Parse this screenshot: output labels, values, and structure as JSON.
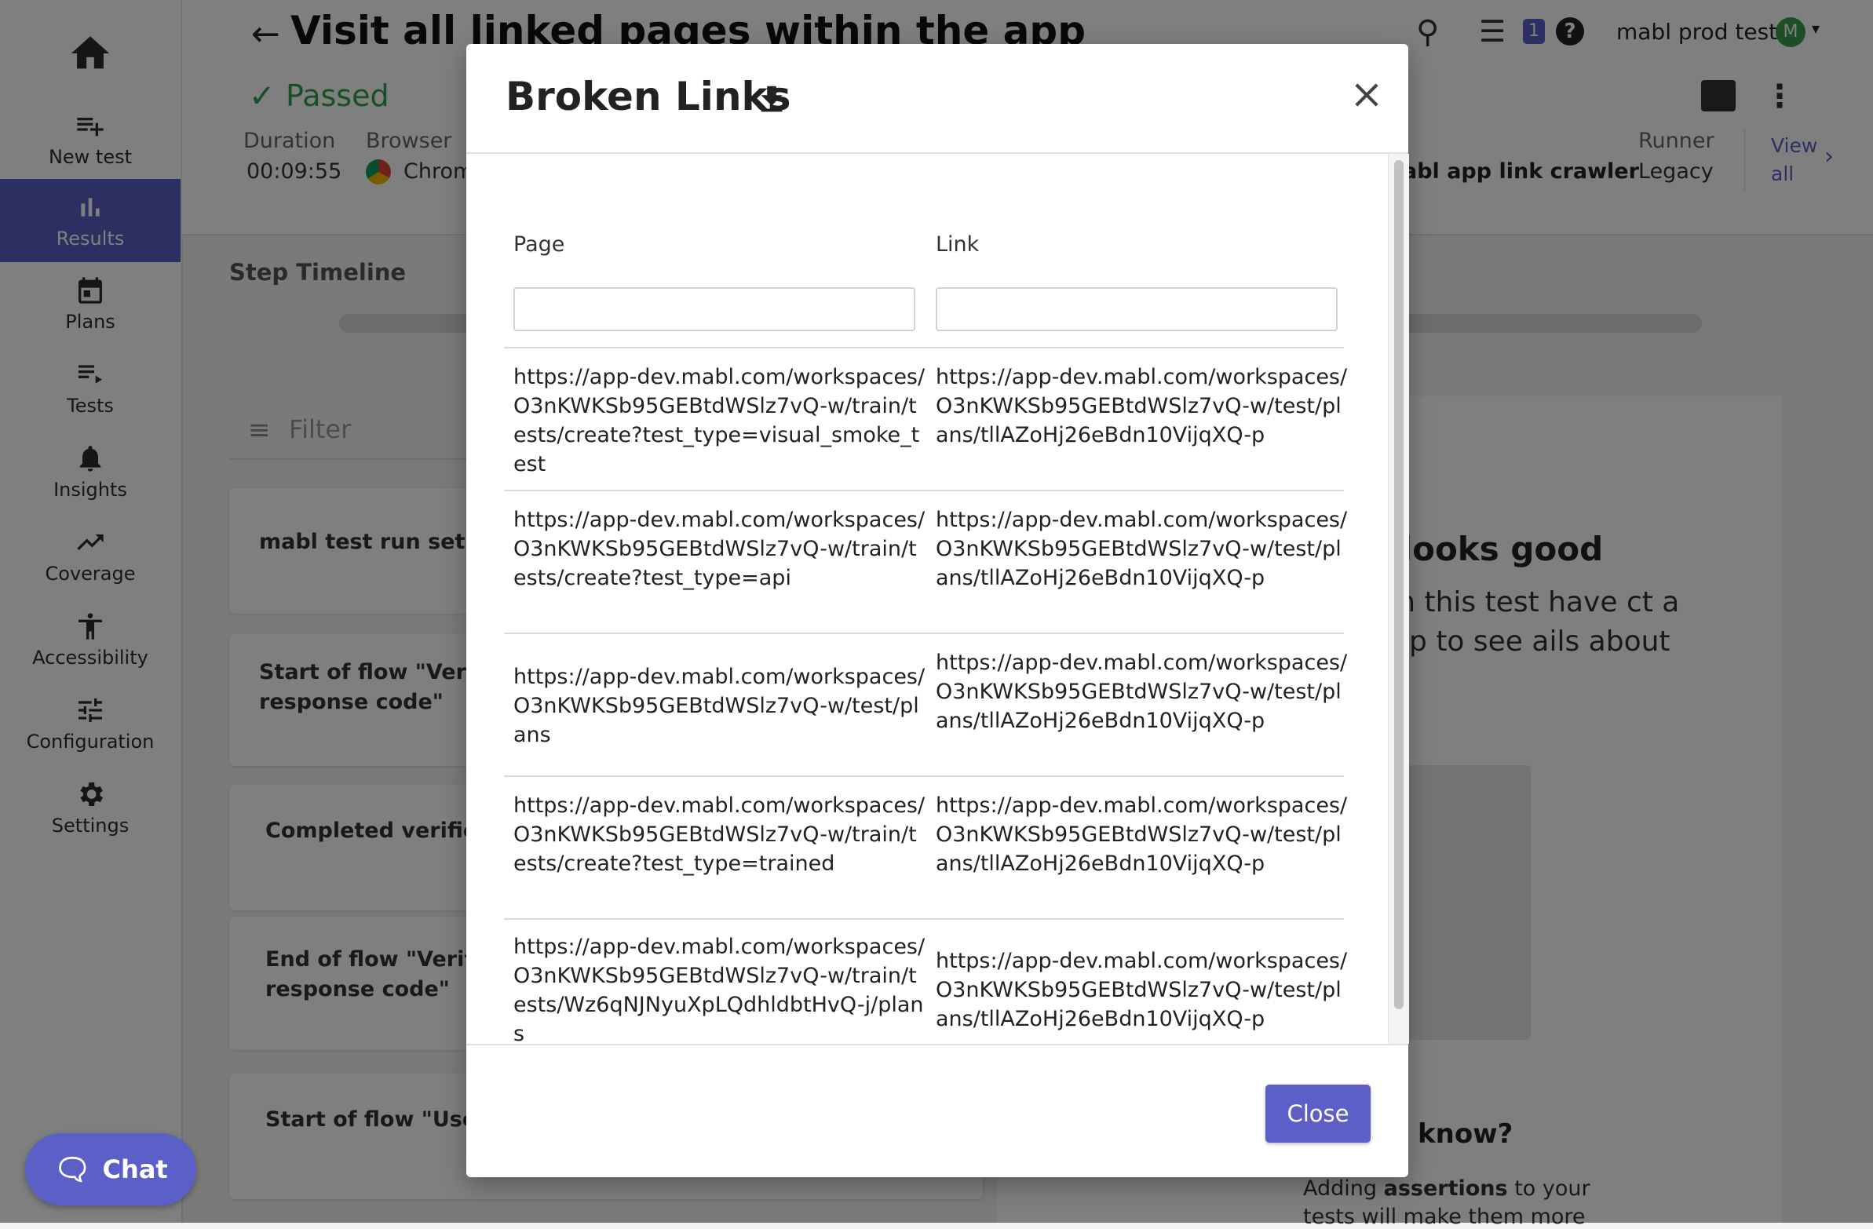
{
  "sidebar": {
    "items": [
      {
        "label": "",
        "icon": "home-icon"
      },
      {
        "label": "New test",
        "icon": "playlist-add-icon"
      },
      {
        "label": "Results",
        "icon": "bar-chart-icon"
      },
      {
        "label": "Plans",
        "icon": "calendar-icon"
      },
      {
        "label": "Tests",
        "icon": "list-icon"
      },
      {
        "label": "Insights",
        "icon": "bell-icon"
      },
      {
        "label": "Coverage",
        "icon": "trending-up-icon"
      },
      {
        "label": "Accessibility",
        "icon": "accessibility-icon"
      },
      {
        "label": "Configuration",
        "icon": "tune-icon"
      },
      {
        "label": "Settings",
        "icon": "gear-icon"
      }
    ],
    "active": "Results"
  },
  "header": {
    "title": "Visit all linked pages within the app",
    "workspace": "mabl prod tests",
    "avatar_initial": "M",
    "notification_count": "1"
  },
  "run": {
    "status": "Passed",
    "duration_label": "Duration",
    "duration_value": "00:09:55",
    "browser_label": "Browser",
    "browser_value": "Chrom",
    "plan_value": "abl app link crawler",
    "runner_label": "Runner",
    "runner_value": "Legacy",
    "view_all": "View all"
  },
  "timeline": {
    "title": "Step Timeline",
    "filter_placeholder": "Filter",
    "steps": [
      "mabl test run setup c",
      "Start of flow \"Verifies response code\"",
      "Completed verificatio",
      "End of flow \"Verifies response code\"",
      "Start of flow \"Uses su"
    ]
  },
  "right_panel": {
    "heading": "g looks good",
    "text": "s in this test have ct a step to see ails about it.",
    "tip_heading": "u know?",
    "tip_text_1": "Adding ",
    "tip_text_bold": "assertions",
    "tip_text_2": " to your",
    "tip_text_3": "tests will make them more"
  },
  "chat": {
    "label": "Chat"
  },
  "modal": {
    "title": "Broken Links",
    "columns": {
      "page": "Page",
      "link": "Link"
    },
    "filters": {
      "page_value": "",
      "link_value": ""
    },
    "rows": [
      {
        "page": "https://app-dev.mabl.com/workspaces/O3nKWKSb95GEBtdWSlz7vQ-w/train/tests/create?test_type=visual_smoke_test",
        "link": "https://app-dev.mabl.com/workspaces/O3nKWKSb95GEBtdWSlz7vQ-w/test/plans/tllAZoHj26eBdn10VijqXQ-p"
      },
      {
        "page": "https://app-dev.mabl.com/workspaces/O3nKWKSb95GEBtdWSlz7vQ-w/train/tests/create?test_type=api",
        "link": "https://app-dev.mabl.com/workspaces/O3nKWKSb95GEBtdWSlz7vQ-w/test/plans/tllAZoHj26eBdn10VijqXQ-p"
      },
      {
        "page": "https://app-dev.mabl.com/workspaces/O3nKWKSb95GEBtdWSlz7vQ-w/test/plans",
        "link": "https://app-dev.mabl.com/workspaces/O3nKWKSb95GEBtdWSlz7vQ-w/test/plans/tllAZoHj26eBdn10VijqXQ-p"
      },
      {
        "page": "https://app-dev.mabl.com/workspaces/O3nKWKSb95GEBtdWSlz7vQ-w/train/tests/create?test_type=trained",
        "link": "https://app-dev.mabl.com/workspaces/O3nKWKSb95GEBtdWSlz7vQ-w/test/plans/tllAZoHj26eBdn10VijqXQ-p"
      },
      {
        "page": "https://app-dev.mabl.com/workspaces/O3nKWKSb95GEBtdWSlz7vQ-w/train/tests/Wz6qNJNyuXpLQdhldbtHvQ-j/plans",
        "link": "https://app-dev.mabl.com/workspaces/O3nKWKSb95GEBtdWSlz7vQ-w/test/plans/tllAZoHj26eBdn10VijqXQ-p"
      }
    ],
    "close_label": "Close"
  },
  "colors": {
    "accent": "#5b5fc7",
    "passed": "#2e9e4f",
    "overlay": "rgba(0,0,0,0.5)"
  }
}
